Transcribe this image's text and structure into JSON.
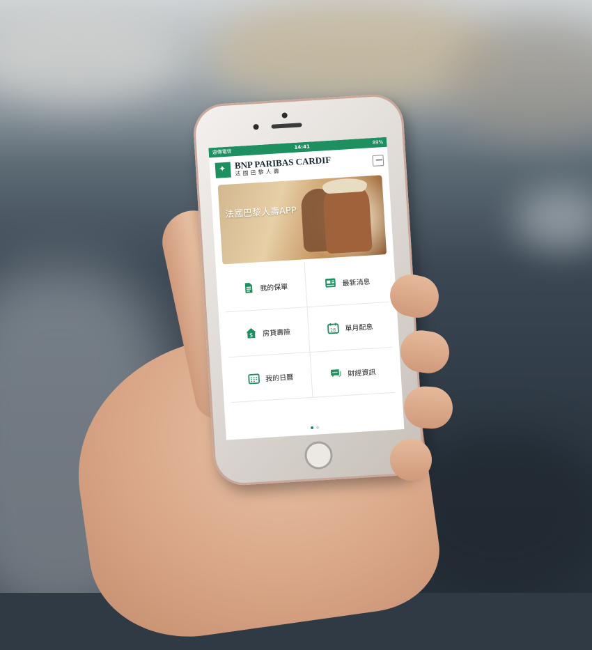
{
  "status_bar": {
    "carrier": "遠傳電信",
    "time": "14:41",
    "battery": "89%"
  },
  "header": {
    "brand": "BNP PARIBAS CARDIF",
    "brand_sub": "法國巴黎人壽"
  },
  "banner": {
    "title": "法國巴黎人壽APP"
  },
  "menu": [
    {
      "label": "我的保單",
      "icon": "document-icon"
    },
    {
      "label": "最新消息",
      "icon": "news-icon"
    },
    {
      "label": "房貸壽險",
      "icon": "house-dollar-icon"
    },
    {
      "label": "單月配息",
      "icon": "calendar-28-icon"
    },
    {
      "label": "我的日曆",
      "icon": "calendar-grid-icon"
    },
    {
      "label": "財經資訊",
      "icon": "chat-icon"
    }
  ],
  "pager": {
    "pages": 2,
    "active": 1
  },
  "colors": {
    "accent": "#1e8f5e"
  }
}
